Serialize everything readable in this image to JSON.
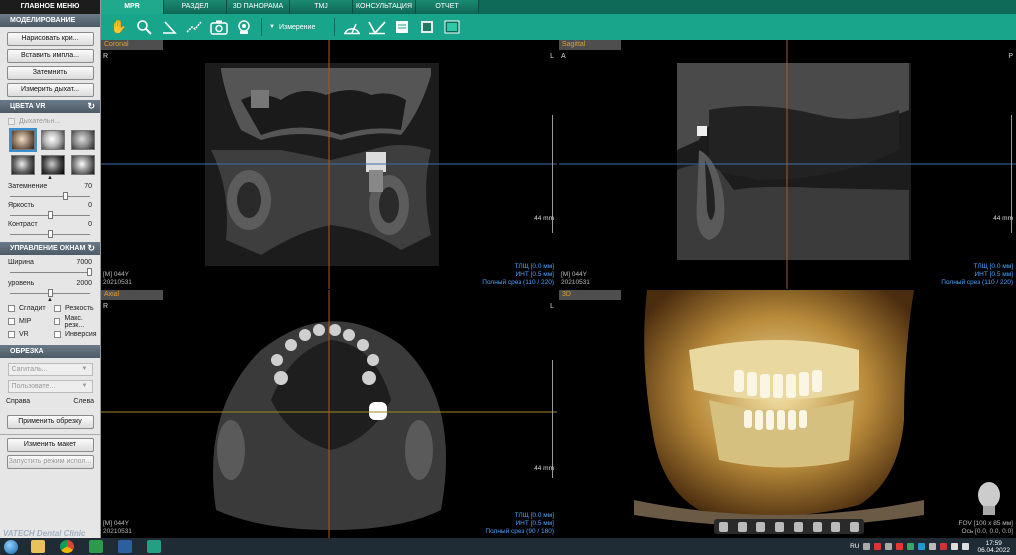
{
  "left_panel": {
    "main_menu": "ГЛАВНОЕ МЕНЮ",
    "modeling": {
      "title": "МОДЕЛИРОВАНИЕ",
      "buttons": [
        "Нарисовать кри...",
        "Вставить импла...",
        "Затемнить",
        "Измерить дыхат..."
      ]
    },
    "vr_colors": {
      "title": "ЦВЕТА VR",
      "breathing_checkbox": "Дыхательн...",
      "darkening_label": "Затемнение",
      "darkening_value": "70",
      "darkening_level": 0.7,
      "brightness_label": "Яркость",
      "brightness_value": "0",
      "brightness_level": 0.5,
      "contrast_label": "Контраст",
      "contrast_value": "0",
      "contrast_level": 0.5
    },
    "window_control": {
      "title": "УПРАВЛЕНИЕ ОКНАМ",
      "width_label": "Ширина",
      "width_value": "7000",
      "width_level": 1.0,
      "level_label": "уровень",
      "level_value": "2000",
      "level_level": 0.5,
      "checkboxes": [
        "Сгладит",
        "Резкость",
        "MIP",
        "Макс. резк...",
        "VR",
        "Инверсия"
      ]
    },
    "crop": {
      "title": "ОБРЕЗКА",
      "dropdown1": "Сагиталь...",
      "dropdown2": "Пользовате...",
      "right_label": "Справа",
      "left_label": "Слева",
      "apply_button": "Применить обрезку"
    },
    "change_layout": "Изменить макет",
    "launch_mode": "Запустить режим испол...",
    "brand": "VATECH Dental Clinic"
  },
  "tabs": [
    "MPR",
    "РАЗДЕЛ",
    "3D ПАНОРАМА",
    "TMJ",
    "КОНСУЛЬТАЦИЯ",
    "ОТЧЕТ"
  ],
  "active_tab": "MPR",
  "toolbar": {
    "measure_label": "Измерение",
    "icons": [
      "hand-icon",
      "zoom-icon",
      "angle-icon",
      "polyline-icon",
      "camera-icon",
      "capture-icon",
      "measure-dropdown-icon",
      "ruler-icon",
      "angle-measure-icon",
      "report-icon",
      "export-icon",
      "layout-icon"
    ]
  },
  "viewports": {
    "coronal": {
      "title": "Coronal",
      "left_orient": "R",
      "right_orient": "L",
      "scale": "44 mm",
      "info_left": [
        "[M] 044Y",
        "20210531"
      ],
      "info_right": [
        "ТЛЩ [0.0 мм]",
        "ИНТ [0.5 мм]",
        "Полный срез (110 / 220)"
      ]
    },
    "sagittal": {
      "title": "Sagittal",
      "left_orient": "A",
      "right_orient": "P",
      "scale": "44 mm",
      "info_left": [
        "[M] 044Y",
        "20210531"
      ],
      "info_right": [
        "ТЛЩ [0.0 мм]",
        "ИНТ [0.5 мм]",
        "Полный срез (110 / 220)"
      ]
    },
    "axial": {
      "title": "Axial",
      "left_orient": "R",
      "right_orient": "L",
      "scale": "44 mm",
      "info_left": [
        "[M] 044Y",
        "20210531"
      ],
      "info_right": [
        "ТЛЩ [0.0 мм]",
        "ИНТ [0.5 мм]",
        "Полный срез (90 / 180)"
      ]
    },
    "three_d": {
      "title": "3D",
      "fov": [
        "FOV [100 x 85 мм]",
        "Ось [0.0, 0.0, 0.0]"
      ]
    }
  },
  "taskbar": {
    "lang": "RU",
    "time": "17:59",
    "date": "06.04.2022"
  },
  "colors": {
    "tab_bg": "#0f6b58",
    "tab_active": "#20a98c",
    "toolbar": "#18a58b",
    "crosshair_h": "#3d6fa6",
    "crosshair_v": "#a05a26",
    "info_blue": "#4aa3ff",
    "title_orange": "#e0a030"
  }
}
